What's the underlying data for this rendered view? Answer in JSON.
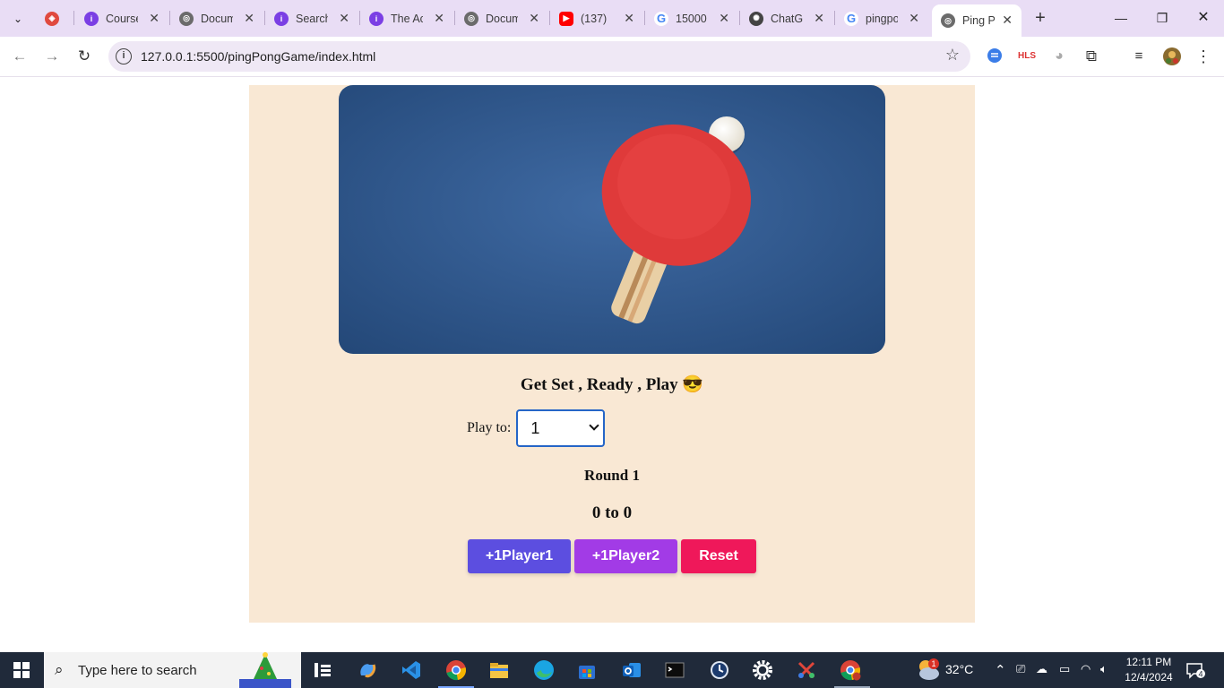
{
  "browser": {
    "tabs": [
      {
        "title": "",
        "favicon_color": "#e04a3f"
      },
      {
        "title": "Course",
        "favicon_color": "#7b3fe4"
      },
      {
        "title": "Docum",
        "favicon_color": "#6b6b6b"
      },
      {
        "title": "Search",
        "favicon_color": "#7b3fe4"
      },
      {
        "title": "The Ac",
        "favicon_color": "#7b3fe4"
      },
      {
        "title": "Docum",
        "favicon_color": "#6b6b6b"
      },
      {
        "title": "(137)",
        "favicon_color": "#ff0000"
      },
      {
        "title": "15000",
        "favicon_color": "#4285f4"
      },
      {
        "title": "ChatG",
        "favicon_color": "#444444"
      },
      {
        "title": "pingpo",
        "favicon_color": "#4285f4"
      },
      {
        "title": "Ping P",
        "favicon_color": "#6b6b6b"
      }
    ],
    "url": "127.0.0.1:5500/pingPongGame/index.html"
  },
  "page": {
    "heading": "Get Set , Ready , Play 😎",
    "play_to_label": "Play to:",
    "play_to_value": "1",
    "round_text": "Round 1",
    "score_text": "0 to 0",
    "buttons": {
      "player1": "+1Player1",
      "player2": "+1Player2",
      "reset": "Reset"
    },
    "colors": {
      "background": "#f9e8d4",
      "player1": "#5c4ee0",
      "player2": "#a23be6",
      "reset": "#ef185a"
    }
  },
  "taskbar": {
    "search_placeholder": "Type here to search",
    "weather": "32°C",
    "weather_badge": "1",
    "time": "12:11 PM",
    "date": "12/4/2024",
    "notification_count": "4"
  }
}
